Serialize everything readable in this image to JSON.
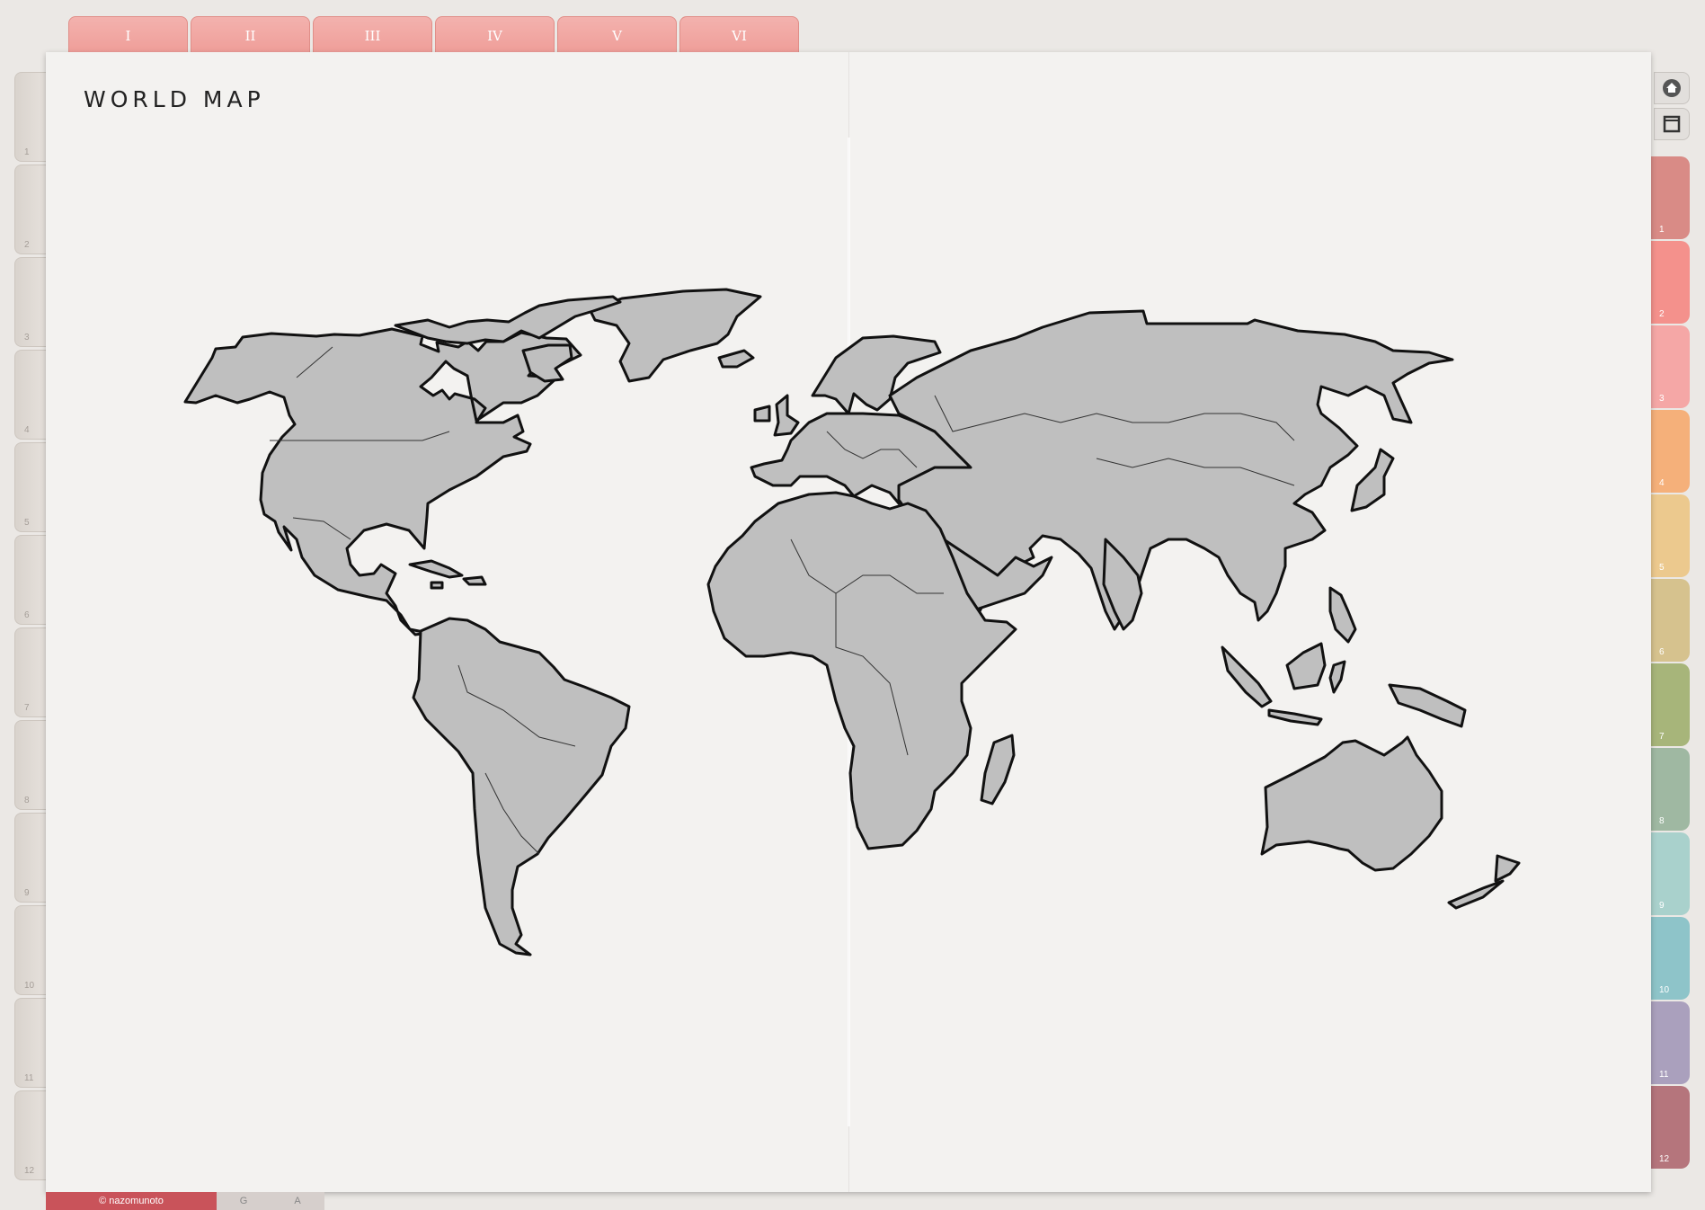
{
  "top_tabs": [
    "I",
    "II",
    "III",
    "IV",
    "V",
    "VI"
  ],
  "left_tabs": [
    "1",
    "2",
    "3",
    "4",
    "5",
    "6",
    "7",
    "8",
    "9",
    "10",
    "11",
    "12"
  ],
  "right_tabs": [
    {
      "label": "1",
      "color": "#d98b86"
    },
    {
      "label": "2",
      "color": "#f4918c"
    },
    {
      "label": "3",
      "color": "#f5a7a6"
    },
    {
      "label": "4",
      "color": "#f5b07a"
    },
    {
      "label": "5",
      "color": "#ecc98e"
    },
    {
      "label": "6",
      "color": "#d6c28e"
    },
    {
      "label": "7",
      "color": "#a7b57a"
    },
    {
      "label": "8",
      "color": "#9fb8a2"
    },
    {
      "label": "9",
      "color": "#a9d1cc"
    },
    {
      "label": "10",
      "color": "#8ec4c9"
    },
    {
      "label": "11",
      "color": "#aaa0bd"
    },
    {
      "label": "12",
      "color": "#b5757c"
    }
  ],
  "side_buttons": [
    "home-icon",
    "page-icon"
  ],
  "title": "WORLD MAP",
  "bottom_tabs": [
    {
      "label": "© nazomunoto",
      "color": "#c9535a"
    },
    {
      "label": "G",
      "color": "#d6cfcc"
    },
    {
      "label": "A",
      "color": "#d6cfcc"
    }
  ]
}
